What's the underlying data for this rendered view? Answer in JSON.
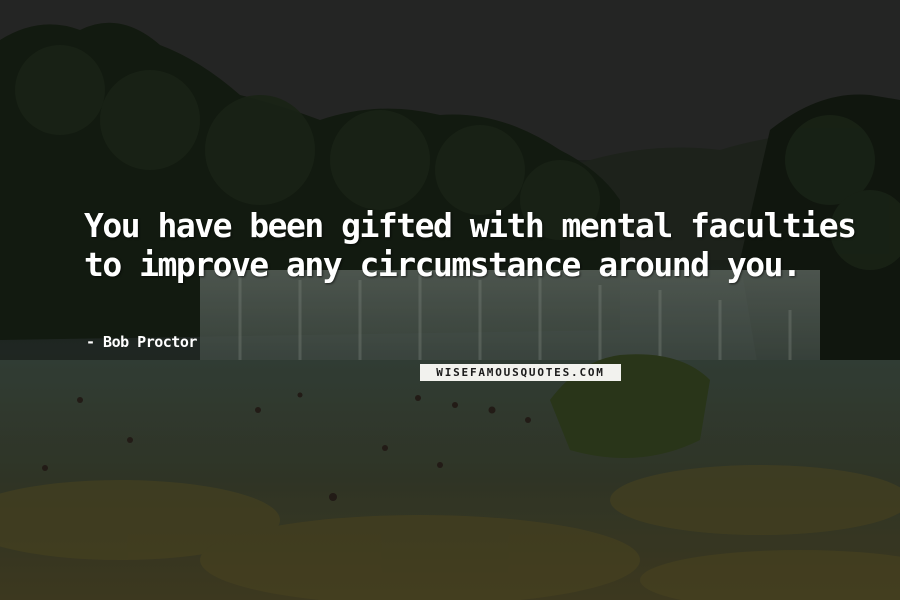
{
  "quote": {
    "lines": [
      "You have been gifted with mental faculties",
      "to improve any circumstance around you."
    ],
    "author": "- Bob Proctor"
  },
  "watermark": "WISEFAMOUSQUOTES.COM",
  "colors": {
    "text": "#ffffff",
    "watermark_bg": "#f2f2ee",
    "watermark_text": "#1b1b1b"
  }
}
